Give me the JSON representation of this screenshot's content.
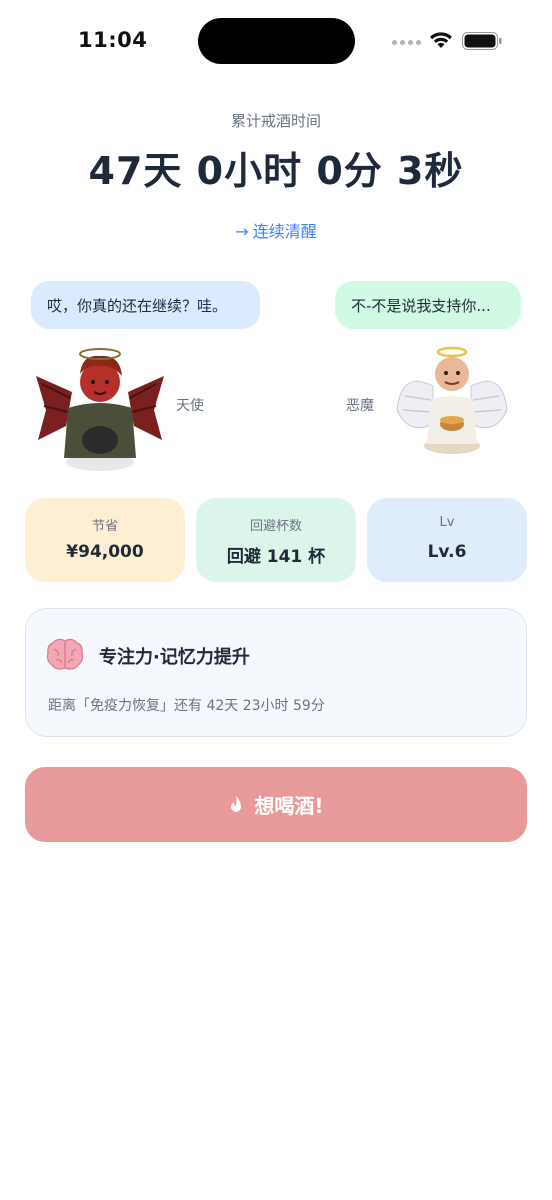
{
  "status_bar": {
    "time": "11:04"
  },
  "header": {
    "subtitle": "累计戒酒时间",
    "counter": "47天 0小时 0分 3秒",
    "link_label": "连续清醒"
  },
  "dialogue": {
    "left_bubble": "哎，你真的还在继续？哇。",
    "right_bubble": "不-不是说我支持你...",
    "left_label": "天使",
    "right_label": "恶魔"
  },
  "stats": [
    {
      "caption": "节省",
      "value": "¥94,000"
    },
    {
      "caption": "回避杯数",
      "value": "回避 141 杯"
    },
    {
      "caption": "Lv",
      "value": "Lv.6"
    }
  ],
  "benefit": {
    "icon": "brain-icon",
    "title": "专注力·记忆力提升",
    "note": "距离「免疫力恢复」还有 42天 23小时 59分"
  },
  "action": {
    "label": "想喝酒!",
    "icon": "flame-icon"
  },
  "colors": {
    "accent_blue": "#3b82f6",
    "action_red": "#e89a9a",
    "card_save": "#fdefd3",
    "card_avoid": "#dcf5ea",
    "card_level": "#dfecfb"
  }
}
